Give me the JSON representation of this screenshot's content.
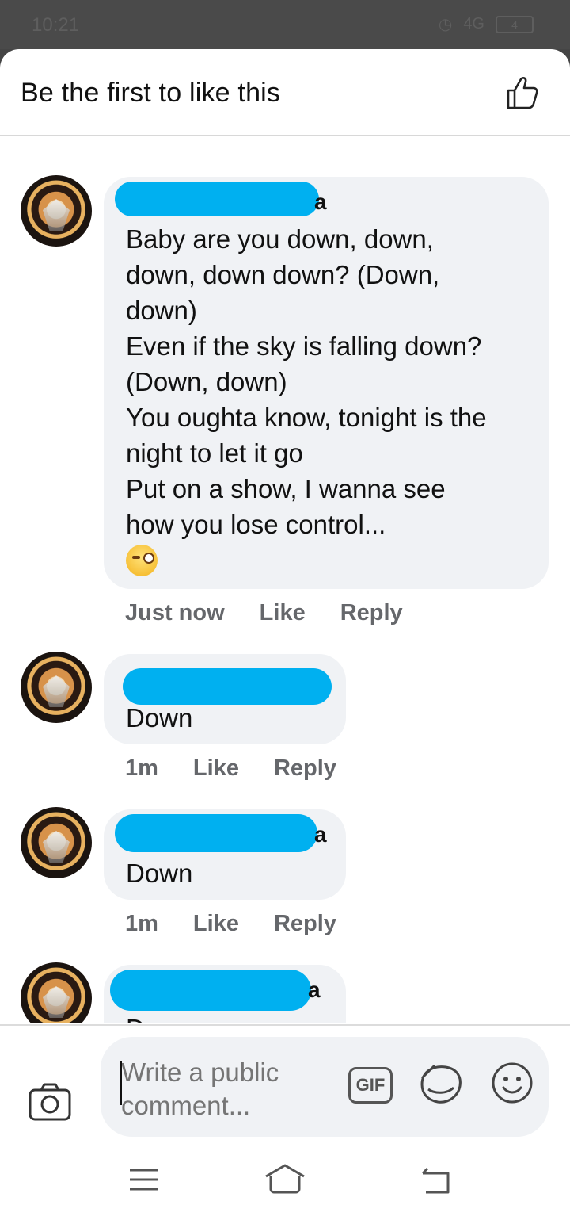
{
  "status_bar": {
    "time": "10:21",
    "network": "4G",
    "battery": "4"
  },
  "header": {
    "title": "Be the first to like this"
  },
  "comments": [
    {
      "name_tail": "a",
      "text": "Baby are you down, down,\ndown, down down? (Down,\ndown)\nEven if the sky is falling down?\n(Down, down)\nYou oughta know, tonight is the\nnight to let it go\nPut on a show, I wanna see\nhow you lose control...",
      "time": "Just now",
      "like_label": "Like",
      "reply_label": "Reply"
    },
    {
      "name_tail": "",
      "text": "Down",
      "time": "1m",
      "like_label": "Like",
      "reply_label": "Reply"
    },
    {
      "name_tail": "a",
      "text": "Down",
      "time": "1m",
      "like_label": "Like",
      "reply_label": "Reply"
    },
    {
      "name_tail": "a",
      "text": "Down",
      "time": "",
      "like_label": "",
      "reply_label": ""
    }
  ],
  "composer": {
    "placeholder": "Write a public comment...",
    "gif_label": "GIF"
  },
  "colors": {
    "bubble": "#f0f2f5",
    "redaction": "#00b0f0",
    "meta_text": "#65676b"
  },
  "icons": {
    "like": "thumbs-up-icon",
    "camera": "camera-icon",
    "gif": "gif-icon",
    "sticker": "sticker-icon",
    "emoji": "smiley-icon",
    "nav": [
      "menu-icon",
      "home-icon",
      "back-icon"
    ]
  }
}
